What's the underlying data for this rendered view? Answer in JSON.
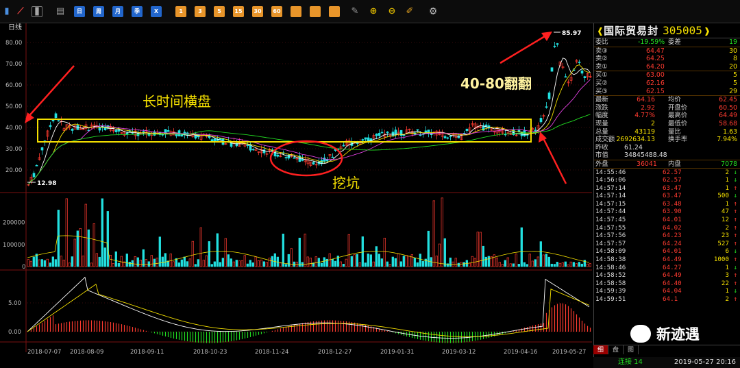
{
  "toolbar": {
    "buttons": [
      "日",
      "周",
      "月",
      "季",
      "X",
      "1",
      "3",
      "5",
      "15",
      "30",
      "60",
      "",
      ""
    ]
  },
  "chart": {
    "period_label": "日线",
    "price_axis": [
      "80.00",
      "70.00",
      "60.00",
      "50.00",
      "40.00",
      "30.00",
      "20.00"
    ],
    "volume_axis": [
      "200000",
      "100000",
      "0"
    ],
    "macd_axis": [
      "5.00",
      "0.00"
    ],
    "x_dates": [
      "2018-07-07",
      "2018-08-09",
      "2018-09-11",
      "2018-10-23",
      "2018-11-24",
      "2018-12-27",
      "2019-01-31",
      "2019-03-12",
      "2019-04-16",
      "2019-05-27"
    ],
    "high_marker": "85.97",
    "low_marker": "12.98"
  },
  "annotations": {
    "sideways": "长时间横盘",
    "pit": "挖坑",
    "double": "40-80翻翻"
  },
  "quote": {
    "name": "国际贸易封",
    "code": "305005",
    "weibi_label": "委比",
    "weibi_value": "-19.59%",
    "weicha_label": "委差",
    "weicha_value": "19",
    "asks": [
      {
        "label": "卖③",
        "price": "64.47",
        "vol": "30"
      },
      {
        "label": "卖②",
        "price": "64.25",
        "vol": "8"
      },
      {
        "label": "卖①",
        "price": "64.20",
        "vol": "20"
      }
    ],
    "bids": [
      {
        "label": "买①",
        "price": "63.00",
        "vol": "5"
      },
      {
        "label": "买②",
        "price": "62.16",
        "vol": "5"
      },
      {
        "label": "买③",
        "price": "62.15",
        "vol": "29"
      }
    ],
    "stats": [
      {
        "l1": "最新",
        "v1": "64.16",
        "l2": "均价",
        "v2": "62.45"
      },
      {
        "l1": "涨跌",
        "v1": "2.92",
        "l2": "开盘价",
        "v2": "60.50"
      },
      {
        "l1": "幅度",
        "v1": "4.77%",
        "l2": "最高价",
        "v2": "64.49"
      },
      {
        "l1": "现量",
        "v1": "2",
        "l2": "最低价",
        "v2": "58.68"
      },
      {
        "l1": "总量",
        "v1": "43119",
        "l2": "量比",
        "v2": "1.63"
      },
      {
        "l1": "成交额",
        "v1": "2692634.13",
        "l2": "换手率",
        "v2": "7.94%"
      },
      {
        "l1": "昨收",
        "v1": "61.24",
        "l2": "",
        "v2": ""
      },
      {
        "l1": "市值",
        "v1": "34845488.48",
        "l2": "",
        "v2": ""
      }
    ],
    "outer_label": "外盘",
    "outer_value": "36041",
    "inner_label": "内盘",
    "inner_value": "7078",
    "ticks": [
      {
        "t": "14:55:46",
        "p": "62.57",
        "v": "2",
        "d": "down"
      },
      {
        "t": "14:56:06",
        "p": "62.57",
        "v": "1",
        "d": "down"
      },
      {
        "t": "14:57:14",
        "p": "63.47",
        "v": "1",
        "d": "up"
      },
      {
        "t": "14:57:14",
        "p": "63.47",
        "v": "500",
        "d": "down"
      },
      {
        "t": "14:57:15",
        "p": "63.48",
        "v": "1",
        "d": "up"
      },
      {
        "t": "14:57:44",
        "p": "63.90",
        "v": "47",
        "d": "up"
      },
      {
        "t": "14:57:45",
        "p": "64.01",
        "v": "12",
        "d": "up"
      },
      {
        "t": "14:57:55",
        "p": "64.02",
        "v": "2",
        "d": "up"
      },
      {
        "t": "14:57:56",
        "p": "64.23",
        "v": "23",
        "d": "up"
      },
      {
        "t": "14:57:57",
        "p": "64.24",
        "v": "527",
        "d": "up"
      },
      {
        "t": "14:58:09",
        "p": "64.01",
        "v": "6",
        "d": "down"
      },
      {
        "t": "14:58:38",
        "p": "64.49",
        "v": "1000",
        "d": "up"
      },
      {
        "t": "14:58:46",
        "p": "64.27",
        "v": "1",
        "d": "down"
      },
      {
        "t": "14:58:52",
        "p": "64.49",
        "v": "3",
        "d": "up"
      },
      {
        "t": "14:58:58",
        "p": "64.40",
        "v": "22",
        "d": "up"
      },
      {
        "t": "14:59:39",
        "p": "64.04",
        "v": "1",
        "d": "down"
      },
      {
        "t": "14:59:51",
        "p": "64.1",
        "v": "2",
        "d": "up"
      }
    ],
    "tabs": [
      "细",
      "盘",
      "图"
    ],
    "status_conn": "连接 14",
    "status_time": "2019-05-27 20:16"
  },
  "watermark": "新迹遇",
  "colors": {
    "up": "#ff3b30",
    "down": "#22dd22",
    "cyan": "#22e0e0",
    "yellow": "#f5e000"
  }
}
